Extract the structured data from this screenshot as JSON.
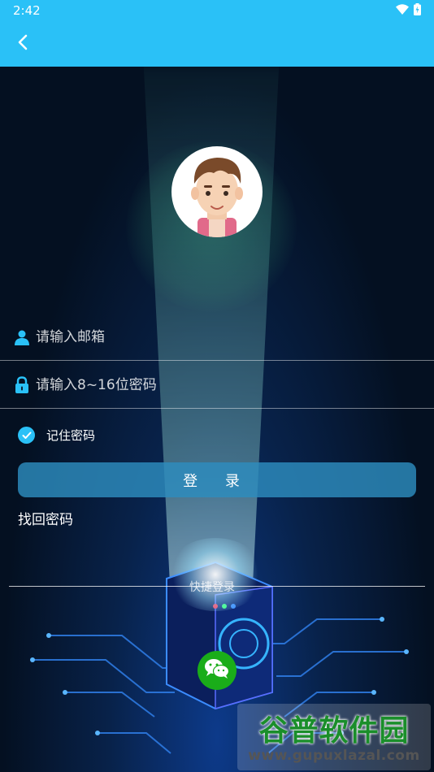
{
  "status_bar": {
    "time": "2:42",
    "icons": [
      "wifi-icon",
      "battery-icon"
    ]
  },
  "app_bar": {
    "back_icon": "back-arrow-icon"
  },
  "colors": {
    "app_bar": "#2ac1f7",
    "checkbox": "#2ac1f7",
    "login_button": "#2d8cbe",
    "wechat": "#1aad19"
  },
  "form": {
    "email_placeholder": "请输入邮箱",
    "email_value": "",
    "password_placeholder": "请输入8~16位密码",
    "password_value": "",
    "remember_label": "记住密码",
    "remember_checked": true,
    "login_label": "登 录",
    "forgot_label": "找回密码"
  },
  "quick_login": {
    "label": "快捷登录",
    "wechat_icon": "wechat-icon"
  },
  "watermark": {
    "logo": "谷普软件园",
    "url": "www.gupuxlazal.com"
  }
}
